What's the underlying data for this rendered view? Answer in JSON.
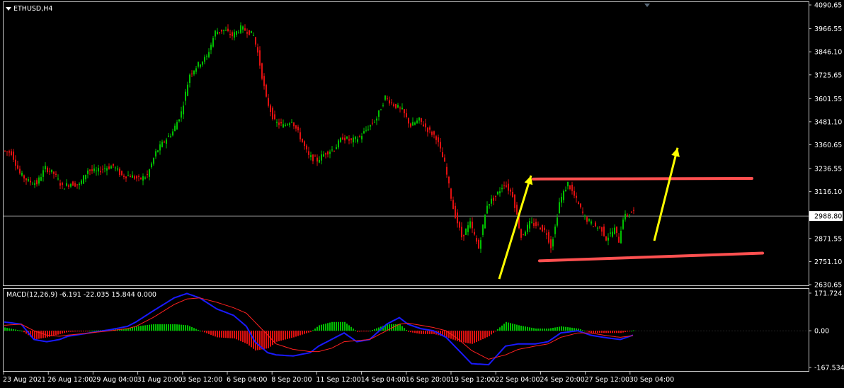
{
  "symbol_label": "ETHUSD,H4",
  "macd_label": "MACD(12,26,9) -6.191 -22.035 15.844 0.000",
  "colors": {
    "background": "#000000",
    "frame": "#c8c8c8",
    "bull": "#00c000",
    "bear": "#e01010",
    "macd_line": "#1a1aff",
    "signal_line": "#ff2020",
    "annotation_arrow": "#ffff00",
    "channel_line": "#ff5050",
    "current_price_line": "#c0c0c0"
  },
  "chart_data": [
    {
      "type": "candlestick",
      "title": "ETHUSD,H4",
      "ylim": [
        2630.65,
        4090.65
      ],
      "y_ticks": [
        "4090.65",
        "3966.55",
        "3846.10",
        "3725.65",
        "3601.55",
        "3481.10",
        "3360.65",
        "3236.55",
        "3116.10",
        "2988.80",
        "2871.55",
        "2751.10",
        "2630.65"
      ],
      "x_ticks": [
        "23 Aug 2021",
        "26 Aug 12:00",
        "29 Aug 04:00",
        "31 Aug 20:00",
        "3 Sep 12:00",
        "6 Sep 04:00",
        "8 Sep 20:00",
        "11 Sep 12:00",
        "14 Sep 04:00",
        "16 Sep 20:00",
        "19 Sep 12:00",
        "22 Sep 04:00",
        "24 Sep 20:00",
        "27 Sep 12:00",
        "30 Sep 04:00"
      ],
      "current_price": 2988.8,
      "price_path": [
        [
          0,
          3330
        ],
        [
          4,
          3320
        ],
        [
          8,
          3210
        ],
        [
          12,
          3170
        ],
        [
          16,
          3160
        ],
        [
          20,
          3240
        ],
        [
          24,
          3210
        ],
        [
          28,
          3140
        ],
        [
          32,
          3160
        ],
        [
          36,
          3150
        ],
        [
          40,
          3230
        ],
        [
          44,
          3220
        ],
        [
          48,
          3240
        ],
        [
          52,
          3250
        ],
        [
          56,
          3200
        ],
        [
          60,
          3200
        ],
        [
          64,
          3180
        ],
        [
          68,
          3200
        ],
        [
          72,
          3320
        ],
        [
          76,
          3380
        ],
        [
          80,
          3430
        ],
        [
          84,
          3530
        ],
        [
          88,
          3730
        ],
        [
          92,
          3780
        ],
        [
          96,
          3820
        ],
        [
          100,
          3950
        ],
        [
          104,
          3960
        ],
        [
          108,
          3930
        ],
        [
          112,
          3970
        ],
        [
          116,
          3950
        ],
        [
          118,
          3930
        ],
        [
          120,
          3840
        ],
        [
          124,
          3600
        ],
        [
          128,
          3480
        ],
        [
          132,
          3460
        ],
        [
          136,
          3490
        ],
        [
          140,
          3400
        ],
        [
          144,
          3300
        ],
        [
          148,
          3280
        ],
        [
          152,
          3320
        ],
        [
          156,
          3340
        ],
        [
          160,
          3400
        ],
        [
          164,
          3380
        ],
        [
          168,
          3400
        ],
        [
          172,
          3450
        ],
        [
          176,
          3500
        ],
        [
          180,
          3610
        ],
        [
          184,
          3570
        ],
        [
          188,
          3540
        ],
        [
          192,
          3460
        ],
        [
          196,
          3490
        ],
        [
          200,
          3440
        ],
        [
          204,
          3400
        ],
        [
          208,
          3260
        ],
        [
          212,
          3030
        ],
        [
          216,
          2880
        ],
        [
          220,
          2950
        ],
        [
          224,
          2820
        ],
        [
          228,
          3050
        ],
        [
          232,
          3090
        ],
        [
          236,
          3160
        ],
        [
          240,
          3100
        ],
        [
          244,
          2880
        ],
        [
          248,
          2950
        ],
        [
          252,
          2940
        ],
        [
          256,
          2900
        ],
        [
          258,
          2830
        ],
        [
          260,
          2930
        ],
        [
          262,
          3060
        ],
        [
          266,
          3160
        ],
        [
          270,
          3070
        ],
        [
          274,
          2980
        ],
        [
          278,
          2940
        ],
        [
          282,
          2920
        ],
        [
          284,
          2870
        ],
        [
          288,
          2920
        ],
        [
          290,
          2860
        ],
        [
          292,
          2980
        ],
        [
          296,
          3010
        ]
      ],
      "channel_upper": [
        3182,
        3185
      ],
      "channel_lower": [
        2755,
        2795
      ]
    },
    {
      "type": "macd",
      "title": "MACD(12,26,9) -6.191 -22.035 15.844 0.000",
      "ylim": [
        -167.534,
        171.724
      ],
      "y_ticks": [
        "171.724",
        "0.00",
        "-167.534"
      ],
      "macd_path": [
        [
          0,
          40
        ],
        [
          8,
          30
        ],
        [
          14,
          -40
        ],
        [
          20,
          -50
        ],
        [
          26,
          -40
        ],
        [
          30,
          -25
        ],
        [
          40,
          -10
        ],
        [
          50,
          5
        ],
        [
          58,
          20
        ],
        [
          62,
          40
        ],
        [
          70,
          90
        ],
        [
          80,
          150
        ],
        [
          86,
          170
        ],
        [
          92,
          150
        ],
        [
          100,
          100
        ],
        [
          108,
          70
        ],
        [
          114,
          20
        ],
        [
          118,
          -50
        ],
        [
          124,
          -100
        ],
        [
          128,
          -110
        ],
        [
          136,
          -115
        ],
        [
          144,
          -100
        ],
        [
          148,
          -70
        ],
        [
          154,
          -40
        ],
        [
          160,
          -10
        ],
        [
          166,
          -50
        ],
        [
          172,
          -40
        ],
        [
          180,
          30
        ],
        [
          186,
          60
        ],
        [
          190,
          30
        ],
        [
          196,
          10
        ],
        [
          202,
          0
        ],
        [
          208,
          -30
        ],
        [
          214,
          -90
        ],
        [
          220,
          -150
        ],
        [
          228,
          -155
        ],
        [
          236,
          -70
        ],
        [
          242,
          -60
        ],
        [
          250,
          -60
        ],
        [
          256,
          -50
        ],
        [
          262,
          -10
        ],
        [
          270,
          0
        ],
        [
          276,
          -20
        ],
        [
          282,
          -30
        ],
        [
          290,
          -40
        ],
        [
          296,
          -20
        ]
      ],
      "signal_path": [
        [
          0,
          25
        ],
        [
          8,
          30
        ],
        [
          14,
          0
        ],
        [
          20,
          -20
        ],
        [
          26,
          -25
        ],
        [
          30,
          -20
        ],
        [
          40,
          -10
        ],
        [
          50,
          0
        ],
        [
          58,
          10
        ],
        [
          62,
          20
        ],
        [
          70,
          60
        ],
        [
          80,
          120
        ],
        [
          86,
          145
        ],
        [
          92,
          150
        ],
        [
          100,
          130
        ],
        [
          108,
          105
        ],
        [
          114,
          80
        ],
        [
          118,
          40
        ],
        [
          124,
          -20
        ],
        [
          128,
          -60
        ],
        [
          136,
          -85
        ],
        [
          144,
          -95
        ],
        [
          148,
          -95
        ],
        [
          154,
          -80
        ],
        [
          160,
          -50
        ],
        [
          166,
          -45
        ],
        [
          172,
          -40
        ],
        [
          180,
          0
        ],
        [
          186,
          30
        ],
        [
          190,
          35
        ],
        [
          196,
          25
        ],
        [
          202,
          15
        ],
        [
          208,
          0
        ],
        [
          214,
          -40
        ],
        [
          220,
          -90
        ],
        [
          228,
          -130
        ],
        [
          236,
          -110
        ],
        [
          242,
          -85
        ],
        [
          250,
          -70
        ],
        [
          256,
          -60
        ],
        [
          262,
          -30
        ],
        [
          270,
          -10
        ],
        [
          276,
          -10
        ],
        [
          282,
          -20
        ],
        [
          290,
          -30
        ],
        [
          296,
          -22
        ]
      ]
    }
  ]
}
